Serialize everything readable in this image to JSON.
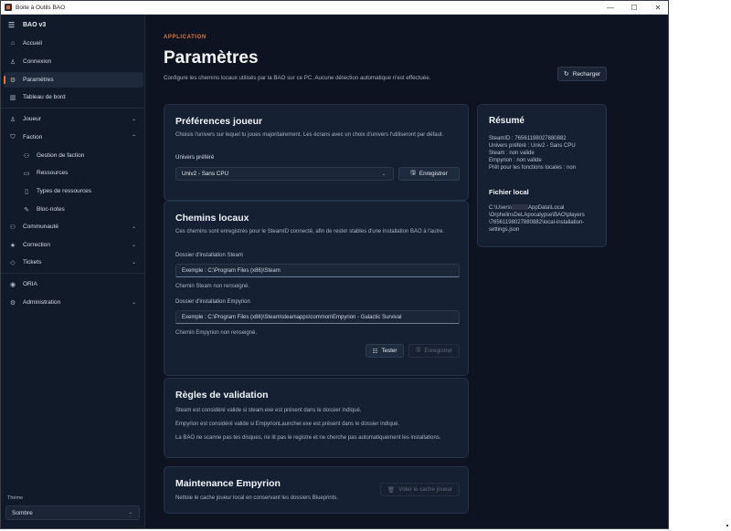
{
  "window": {
    "title": "Boite à Outils BAO",
    "controls": {
      "minimize": "—",
      "maximize": "☐",
      "close": "✕"
    }
  },
  "sidebar": {
    "brand": "BAO v3",
    "items": [
      {
        "label": "Accueil",
        "icon": "home-icon"
      },
      {
        "label": "Connexion",
        "icon": "user-icon"
      },
      {
        "label": "Paramètres",
        "icon": "gear-icon",
        "active": true
      },
      {
        "label": "Tableau de bord",
        "icon": "dashboard-icon"
      },
      {
        "label": "Joueur",
        "icon": "user-icon"
      },
      {
        "label": "Faction",
        "icon": "shield-icon"
      },
      {
        "label": "Gestion de faction",
        "icon": "users-icon"
      },
      {
        "label": "Ressources",
        "icon": "folder-icon"
      },
      {
        "label": "Types de ressources",
        "icon": "file-icon"
      },
      {
        "label": "Bloc-notes",
        "icon": "edit-icon"
      },
      {
        "label": "Communauté",
        "icon": "community-icon"
      },
      {
        "label": "Correction",
        "icon": "star-icon"
      },
      {
        "label": "Tickets",
        "icon": "tag-icon"
      },
      {
        "label": "ORIA",
        "icon": "circle-icon"
      },
      {
        "label": "Administration",
        "icon": "gear-icon"
      }
    ],
    "theme_label": "Thème",
    "theme_value": "Sombre"
  },
  "header": {
    "eyebrow": "APPLICATION",
    "title": "Paramètres",
    "subtitle": "Configure les chemins locaux utilisés par la BAO sur ce PC. Aucune détection automatique n'est effectuée.",
    "reload_label": "Recharger"
  },
  "prefs": {
    "title": "Préférences joueur",
    "desc": "Choisis l'univers sur lequel tu joues majoritairement. Les écrans avec un choix d'univers l'utiliseront par défaut.",
    "field_label": "Univers préféré",
    "select_value": "Univ2 - Sans CPU",
    "save_label": "Enregistrer"
  },
  "paths": {
    "title": "Chemins locaux",
    "desc": "Ces chemins sont enregistrés pour le SteamID connecté, afin de rester stables d'une installation BAO à l'autre.",
    "steam_label": "Dossier d'installation Steam",
    "steam_placeholder": "Exemple : C:\\Program Files (x86)\\Steam",
    "steam_status": "Chemin Steam non renseigné.",
    "empyrion_label": "Dossier d'installation Empyrion",
    "empyrion_placeholder": "Exemple : C:\\Program Files (x86)\\Steam\\steamapps\\common\\Empyrion - Galactic Survival",
    "empyrion_status": "Chemin Empyrion non renseigné.",
    "test_label": "Tester",
    "save_label": "Enregistrer"
  },
  "rules": {
    "title": "Règles de validation",
    "line1": "Steam est considéré valide si steam.exe est présent dans le dossier indiqué.",
    "line2": "Empyrion est considéré valide si EmpyrionLauncher.exe est présent dans le dossier indiqué.",
    "line3": "La BAO ne scanne pas tes disques, ne lit pas le registre et ne cherche pas automatiquement les installations."
  },
  "maintenance": {
    "title": "Maintenance Empyrion",
    "desc": "Nettoie le cache joueur local en conservant les dossiers Blueprints.",
    "clear_label": "Vider le cache joueur"
  },
  "summary": {
    "title": "Résumé",
    "steamid": "SteamID : 76561198027880882",
    "universe": "Univers préféré : Univ2 - Sans CPU",
    "steam": "Steam : non valide",
    "empyrion": "Empyrion : non valide",
    "ready": "Prêt pour les fonctions locales : non",
    "file_title": "Fichier local",
    "path1a": "C:\\Users\\",
    "path1b": "AppData\\Local",
    "path2": "\\OrphelinsDeLApocalypse\\BAO\\players",
    "path3": "\\76561198027880882\\local-installation-",
    "path4": "settings.json"
  },
  "colors": {
    "accent": "#e07b3c",
    "background": "#0d1320",
    "card": "#152033"
  }
}
